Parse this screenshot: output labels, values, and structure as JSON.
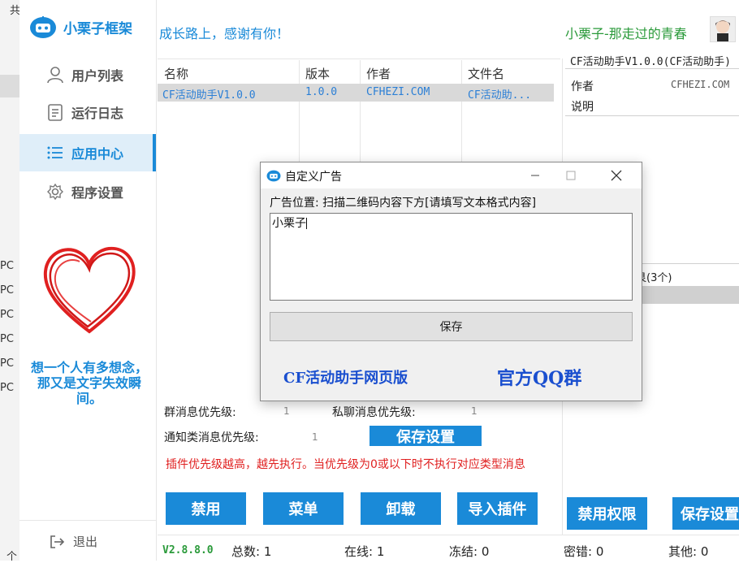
{
  "background": {
    "top_char": "共",
    "pc_labels": [
      "PC",
      "PC",
      "PC",
      "PC",
      "PC",
      "PC"
    ],
    "bottom_char": "个"
  },
  "app": {
    "logo_text": "小栗子框架",
    "slogan": "成长路上，感谢有你！",
    "user_name": "小栗子-那走过的青春",
    "accent": "#1a8ad8"
  },
  "sidebar": {
    "items": [
      {
        "label": "用户列表",
        "icon": "user-icon"
      },
      {
        "label": "运行日志",
        "icon": "log-icon"
      },
      {
        "label": "应用中心",
        "icon": "list-icon"
      },
      {
        "label": "程序设置",
        "icon": "gear-icon"
      }
    ],
    "quote": "想一个人有多想念，那又是文字失效瞬间。",
    "exit_label": "退出"
  },
  "plugin_table": {
    "headers": [
      "名称",
      "版本",
      "作者",
      "文件名"
    ],
    "rows": [
      {
        "name": "CF活动助手V1.0.0",
        "version": "1.0.0",
        "author": "CFHEZI.COM",
        "file": "CF活动助..."
      }
    ]
  },
  "detail_panel": {
    "title": "CF活动助手V1.0.0(CF活动助手)",
    "author_label": "作者",
    "author_value": "CFHEZI.COM",
    "desc_label": "说明",
    "permissions_fragment": "艮(3个)"
  },
  "priority": {
    "group_label": "群消息优先级:",
    "group_value": "1",
    "private_label": "私聊消息优先级:",
    "private_value": "1",
    "notice_label": "通知类消息优先级:",
    "notice_value": "1",
    "save_label": "保存设置",
    "warning": "插件优先级越高，越先执行。当优先级为0或以下时不执行对应类型消息"
  },
  "actions": {
    "disable": "禁用",
    "menu": "菜单",
    "uninstall": "卸载",
    "import": "导入插件",
    "disable_perm": "禁用权限",
    "save_settings": "保存设置"
  },
  "status": {
    "version": "V2.8.8.0",
    "total": "总数: 1",
    "online": "在线: 1",
    "frozen": "冻结: 0",
    "pwd_error": "密错: 0",
    "other": "其他: 0"
  },
  "dialog": {
    "title": "自定义广告",
    "position_label": "广告位置: 扫描二维码内容下方[请填写文本格式内容]",
    "content": "小栗子",
    "save_label": "保存",
    "link_web": "CF活动助手网页版",
    "link_qq": "官方QQ群",
    "link_color": "#1a4fcf"
  }
}
